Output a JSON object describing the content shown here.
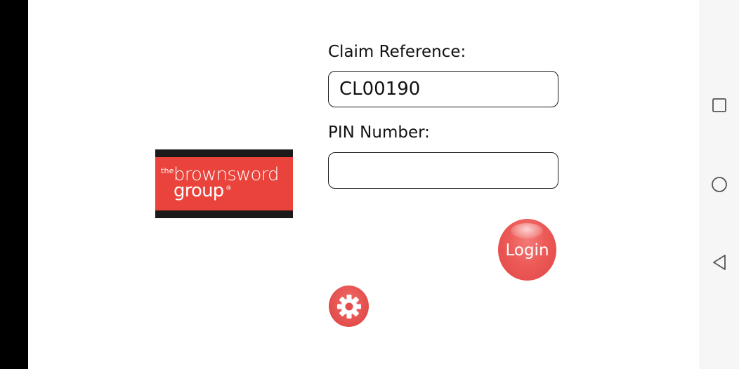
{
  "form": {
    "claim_label": "Claim Reference:",
    "claim_value": "CL00190",
    "pin_label": "PIN Number:",
    "pin_value": ""
  },
  "logo": {
    "the": "the",
    "brand": "brownsword",
    "group": "group",
    "registered": "®"
  },
  "buttons": {
    "login_label": "Login"
  },
  "icons": {
    "settings": "gear-icon",
    "recents": "square-icon",
    "home": "circle-icon",
    "back": "triangle-back-icon"
  },
  "colors": {
    "accent": "#e9433b",
    "login": "#ec5a57"
  }
}
